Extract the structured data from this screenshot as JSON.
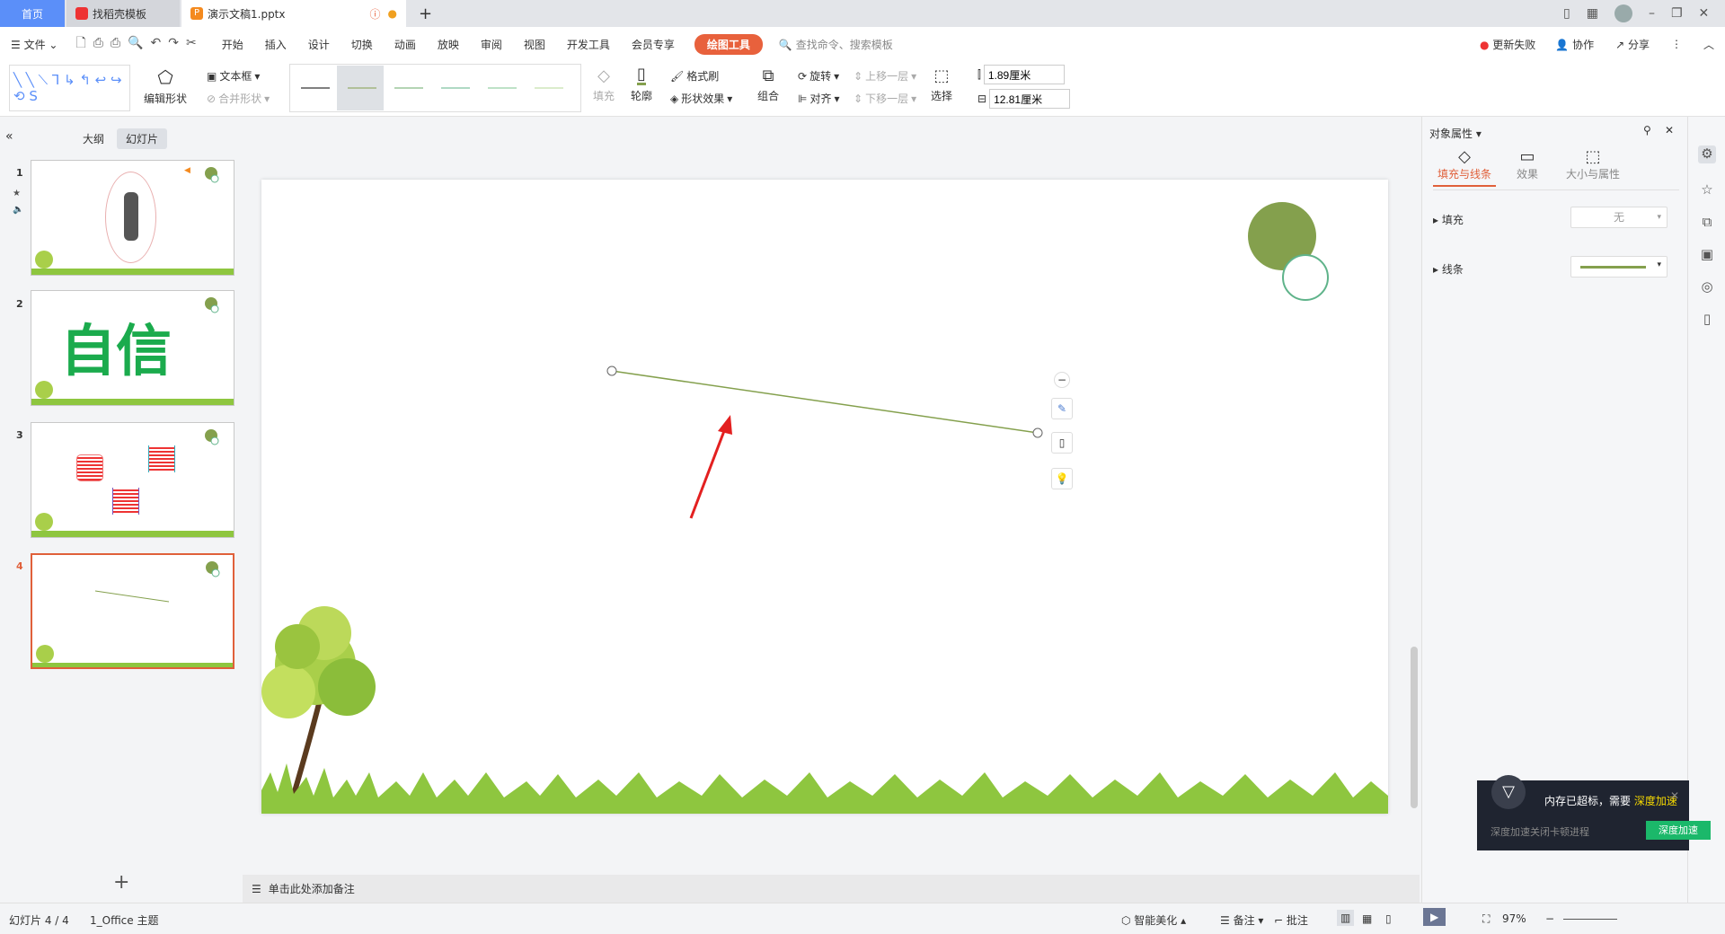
{
  "tabs": [
    {
      "label": "首页"
    },
    {
      "label": "找稻壳模板"
    },
    {
      "label": "演示文稿1.pptx"
    }
  ],
  "menu": {
    "file": "文件",
    "items": [
      "开始",
      "插入",
      "设计",
      "切换",
      "动画",
      "放映",
      "审阅",
      "视图",
      "开发工具",
      "会员专享"
    ],
    "active": "绘图工具",
    "search": "查找命令、搜索模板",
    "update": "更新失败",
    "collab": "协作",
    "share": "分享"
  },
  "ribbon": {
    "edit_shape": "编辑形状",
    "textbox": "文本框",
    "merge": "合并形状",
    "fill": "填充",
    "outline": "轮廓",
    "format_painter": "格式刷",
    "shape_effect": "形状效果",
    "group": "组合",
    "rotate": "旋转",
    "align": "对齐",
    "up": "上移一层",
    "down": "下移一层",
    "select": "选择",
    "height": "1.89厘米",
    "width": "12.81厘米"
  },
  "left": {
    "outline": "大纲",
    "slides": "幻灯片",
    "numbers": [
      "1",
      "2",
      "3",
      "4"
    ],
    "slide2_text": "自信"
  },
  "right": {
    "title": "对象属性",
    "tabs": [
      "填充与线条",
      "效果",
      "大小与属性"
    ],
    "fill_label": "填充",
    "fill_value": "无",
    "line_label": "线条",
    "line_color": "#84a04d"
  },
  "notes": "单击此处添加备注",
  "status": {
    "slide": "幻灯片 4 / 4",
    "theme": "1_Office 主题",
    "beautify": "智能美化",
    "notes": "备注",
    "comment": "批注",
    "zoom": "97%"
  },
  "toast": {
    "msg": "内存已超标，需要",
    "highlight": "深度加速",
    "sub": "深度加速关闭卡顿进程",
    "button": "深度加速"
  },
  "colors": {
    "accent": "#e8613c",
    "green": "#84a04d",
    "home_tab": "#5b8ff9"
  }
}
